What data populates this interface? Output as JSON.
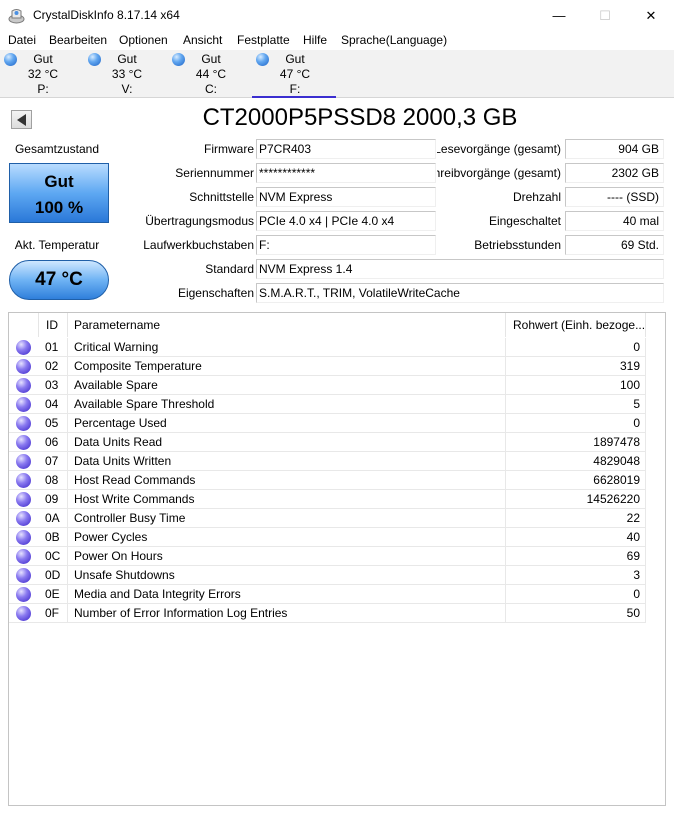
{
  "window": {
    "title": "CrystalDiskInfo 8.17.14 x64",
    "min_glyph": "—",
    "max_glyph": "☐",
    "close_glyph": "✕"
  },
  "menu": [
    "Datei",
    "Bearbeiten",
    "Optionen",
    "Ansicht",
    "Festplatte",
    "Hilfe",
    "Sprache(Language)"
  ],
  "drives": [
    {
      "status": "Gut",
      "temp": "32 °C",
      "letter": "P:",
      "selected": false
    },
    {
      "status": "Gut",
      "temp": "33 °C",
      "letter": "V:",
      "selected": false
    },
    {
      "status": "Gut",
      "temp": "44 °C",
      "letter": "C:",
      "selected": false
    },
    {
      "status": "Gut",
      "temp": "47 °C",
      "letter": "F:",
      "selected": true
    }
  ],
  "drive_title": "CT2000P5PSSD8 2000,3 GB",
  "health": {
    "label": "Gesamtzustand",
    "status": "Gut",
    "percent": "100 %",
    "temp_label": "Akt. Temperatur",
    "temp": "47 °C",
    "color": "#5ea8f2"
  },
  "info": {
    "firmware_label": "Firmware",
    "firmware": "P7CR403",
    "serial_label": "Seriennummer",
    "serial": "************",
    "interface_label": "Schnittstelle",
    "interface": "NVM Express",
    "transfer_label": "Übertragungsmodus",
    "transfer": "PCIe 4.0 x4 | PCIe 4.0 x4",
    "letters_label": "Laufwerkbuchstaben",
    "letters": "F:",
    "standard_label": "Standard",
    "standard": "NVM Express 1.4",
    "features_label": "Eigenschaften",
    "features": "S.M.A.R.T., TRIM, VolatileWriteCache",
    "reads_label": "Lesevorgänge (gesamt)",
    "reads": "904 GB",
    "writes_label": "Schreibvorgänge (gesamt)",
    "writes": "2302 GB",
    "rpm_label": "Drehzahl",
    "rpm": "---- (SSD)",
    "power_count_label": "Eingeschaltet",
    "power_count": "40 mal",
    "hours_label": "Betriebsstunden",
    "hours": "69 Std."
  },
  "smart": {
    "headers": {
      "id": "ID",
      "name": "Parametername",
      "raw": "Rohwert (Einh. bezoge..."
    },
    "rows": [
      {
        "id": "01",
        "name": "Critical Warning",
        "raw": "0"
      },
      {
        "id": "02",
        "name": "Composite Temperature",
        "raw": "319"
      },
      {
        "id": "03",
        "name": "Available Spare",
        "raw": "100"
      },
      {
        "id": "04",
        "name": "Available Spare Threshold",
        "raw": "5"
      },
      {
        "id": "05",
        "name": "Percentage Used",
        "raw": "0"
      },
      {
        "id": "06",
        "name": "Data Units Read",
        "raw": "1897478"
      },
      {
        "id": "07",
        "name": "Data Units Written",
        "raw": "4829048"
      },
      {
        "id": "08",
        "name": "Host Read Commands",
        "raw": "6628019"
      },
      {
        "id": "09",
        "name": "Host Write Commands",
        "raw": "14526220"
      },
      {
        "id": "0A",
        "name": "Controller Busy Time",
        "raw": "22"
      },
      {
        "id": "0B",
        "name": "Power Cycles",
        "raw": "40"
      },
      {
        "id": "0C",
        "name": "Power On Hours",
        "raw": "69"
      },
      {
        "id": "0D",
        "name": "Unsafe Shutdowns",
        "raw": "3"
      },
      {
        "id": "0E",
        "name": "Media and Data Integrity Errors",
        "raw": "0"
      },
      {
        "id": "0F",
        "name": "Number of Error Information Log Entries",
        "raw": "50"
      }
    ]
  }
}
